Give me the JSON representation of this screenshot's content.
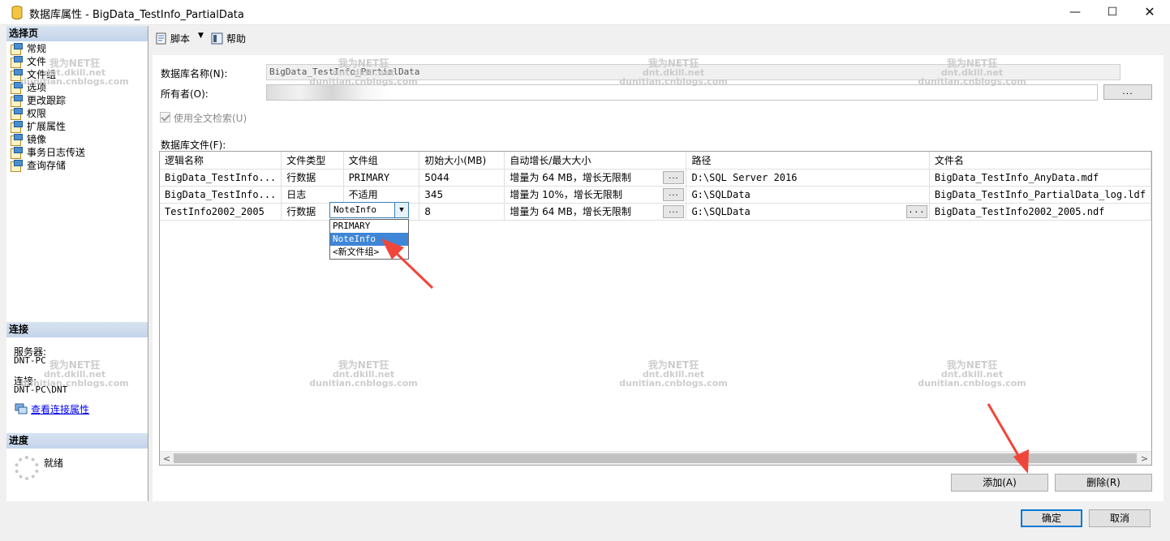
{
  "window": {
    "title": "数据库属性 - BigData_TestInfo_PartialData",
    "minimize": "—",
    "maximize": "☐",
    "close": "✕"
  },
  "left": {
    "select_page_header": "选择页",
    "nav": [
      "常规",
      "文件",
      "文件组",
      "选项",
      "更改跟踪",
      "权限",
      "扩展属性",
      "镜像",
      "事务日志传送",
      "查询存储"
    ],
    "connection_header": "连接",
    "server_label": "服务器:",
    "server_value": "DNT-PC",
    "connection_label": "连接:",
    "connection_value": "DNT-PC\\DNT",
    "view_conn_props": "查看连接属性",
    "progress_header": "进度",
    "progress_status": "就绪"
  },
  "toolbar": {
    "script": "脚本",
    "dropdown": "▼",
    "help": "帮助"
  },
  "form": {
    "db_name_label": "数据库名称(N):",
    "db_name_value": "BigData_TestInfo_PartialData",
    "owner_label": "所有者(O):",
    "owner_value": "",
    "owner_browse": "...",
    "fulltext_label": "使用全文检索(U)",
    "files_label": "数据库文件(F):"
  },
  "grid": {
    "columns": [
      "逻辑名称",
      "文件类型",
      "文件组",
      "初始大小(MB)",
      "自动增长/最大大小",
      "路径",
      "文件名"
    ],
    "rows": [
      [
        "BigData_TestInfo...",
        "行数据",
        "PRIMARY",
        "5044",
        "增量为 64 MB，增长无限制",
        "D:\\SQL Server 2016",
        "BigData_TestInfo_AnyData.mdf"
      ],
      [
        "BigData_TestInfo...",
        "日志",
        "不适用",
        "345",
        "增量为 10%，增长无限制",
        "G:\\SQLData",
        "BigData_TestInfo_PartialData_log.ldf"
      ],
      [
        "TestInfo2002_2005",
        "行数据",
        "NoteInfo",
        "8",
        "增量为 64 MB，增长无限制",
        "G:\\SQLData",
        "BigData_TestInfo2002_2005.ndf"
      ]
    ],
    "cell_button": "...",
    "filegroup_options": [
      "PRIMARY",
      "NoteInfo",
      "<新文件组>"
    ],
    "filegroup_selected": "NoteInfo",
    "scroll_left": "<",
    "scroll_right": ">"
  },
  "buttons": {
    "add": "添加(A)",
    "remove": "删除(R)",
    "ok": "确定",
    "cancel": "取消"
  },
  "watermark": {
    "line1": "我为NET狂",
    "line2": "dnt.dkill.net",
    "line3": "dunitian.cnblogs.com"
  },
  "colors": {
    "accent": "#0078d7",
    "selection": "#3f86d6",
    "annotation_arrow": "#f0453a",
    "section_header": "#c3d4ea"
  }
}
